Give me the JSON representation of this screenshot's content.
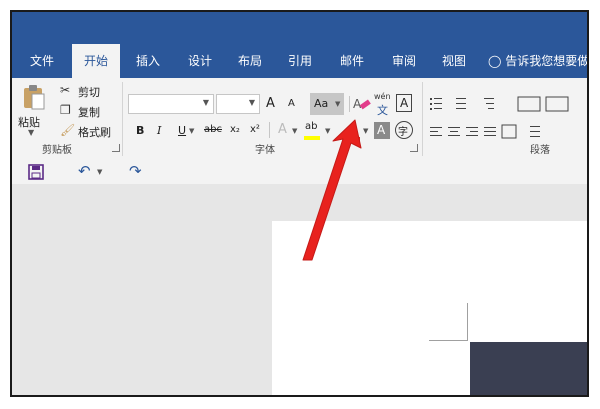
{
  "tabs": [
    {
      "label": "文件"
    },
    {
      "label": "开始",
      "active": true
    },
    {
      "label": "插入"
    },
    {
      "label": "设计"
    },
    {
      "label": "布局"
    },
    {
      "label": "引用"
    },
    {
      "label": "邮件"
    },
    {
      "label": "审阅"
    },
    {
      "label": "视图"
    }
  ],
  "tell_me": "告诉我您想要做",
  "clipboard": {
    "paste": "粘贴",
    "cut": "剪切",
    "copy": "复制",
    "format_painter": "格式刷",
    "group_label": "剪贴板"
  },
  "font": {
    "font_name": "",
    "font_size": "",
    "grow": "A",
    "shrink": "A",
    "change_case": "Aa",
    "bold": "B",
    "italic": "I",
    "underline": "U",
    "strike": "abc",
    "subscript": "x₂",
    "superscript": "x²",
    "text_effects": "A",
    "highlight": "ab",
    "font_color": "A",
    "char_shading": "A",
    "enclose": "字",
    "phonetic_top": "wén",
    "phonetic_bottom": "文",
    "char_border": "A",
    "group_label": "字体"
  },
  "paragraph": {
    "group_label": "段落"
  },
  "colors": {
    "ribbon_blue": "#2b579a",
    "arrow_red": "#e8221e"
  },
  "icons": [
    "save-icon",
    "undo-icon",
    "redo-icon",
    "clear-formatting-icon",
    "cut-icon",
    "copy-icon",
    "format-painter-icon",
    "paste-icon",
    "lightbulb-icon"
  ]
}
